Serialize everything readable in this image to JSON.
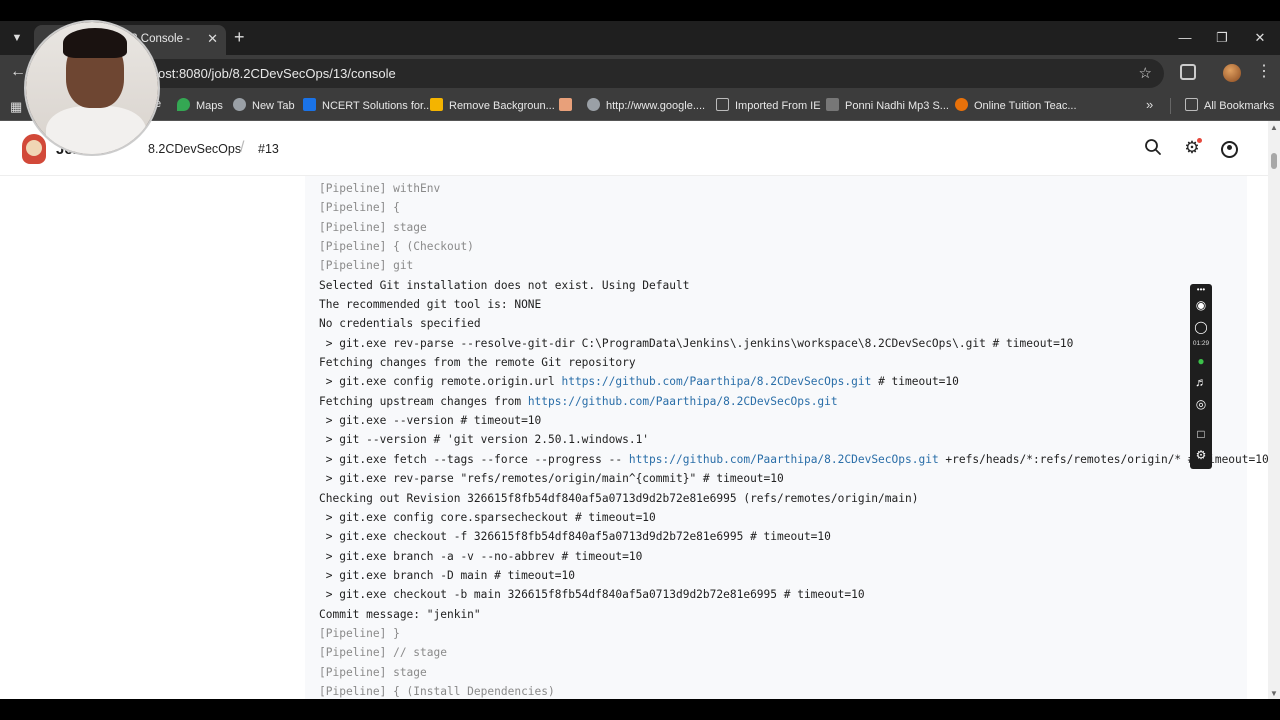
{
  "browser": {
    "tab_title": "#13 Console -",
    "url": "localhost:8080/job/8.2CDevSecOps/13/console",
    "url_visible": "ost:8080/job/8.2CDevSecOps/13/console",
    "icons": {
      "tab_list": "chevron-down-icon",
      "close": "close-icon",
      "new_tab": "plus-icon",
      "back": "back-arrow-icon",
      "star": "star-icon",
      "extensions": "puzzle-icon",
      "menu": "kebab-menu-icon"
    }
  },
  "bookmarks": {
    "items": [
      {
        "label": "e",
        "icon": "bookmark-icon",
        "color": "#555555"
      },
      {
        "label": "Maps",
        "icon": "maps-icon",
        "color": "#34a853"
      },
      {
        "label": "New Tab",
        "icon": "globe-icon",
        "color": "#9aa0a6"
      },
      {
        "label": "NCERT Solutions for...",
        "icon": "ncert-icon",
        "color": "#1a73e8"
      },
      {
        "label": "Remove Backgroun...",
        "icon": "removebg-icon",
        "color": "#f4b400"
      },
      {
        "label": "",
        "icon": "image-icon",
        "color": "#e8a07a"
      },
      {
        "label": "http://www.google....",
        "icon": "globe-icon",
        "color": "#9aa0a6"
      },
      {
        "label": "Imported From IE",
        "icon": "folder-icon",
        "color": "#9aa0a6"
      },
      {
        "label": "Ponni Nadhi Mp3 S...",
        "icon": "music-icon",
        "color": "#777777"
      },
      {
        "label": "Online Tuition Teac...",
        "icon": "v-logo-icon",
        "color": "#e8710a"
      }
    ],
    "all_bookmarks": "All Bookmarks"
  },
  "jenkins": {
    "brand": "Jenkins",
    "brand_visible": "Je...s",
    "breadcrumb": [
      "8.2CDevSecOps",
      "#13"
    ],
    "header_icons": [
      "search-icon",
      "gear-icon",
      "user-icon"
    ]
  },
  "console": {
    "lines": [
      {
        "t": "[Pipeline] withEnv",
        "kind": "pipe"
      },
      {
        "t": "[Pipeline] {",
        "kind": "pipe"
      },
      {
        "t": "[Pipeline] stage",
        "kind": "pipe"
      },
      {
        "t": "[Pipeline] { (Checkout)",
        "kind": "pipe"
      },
      {
        "t": "[Pipeline] git",
        "kind": "pipe"
      },
      {
        "t": "Selected Git installation does not exist. Using Default",
        "kind": "text"
      },
      {
        "t": "The recommended git tool is: NONE",
        "kind": "text"
      },
      {
        "t": "No credentials specified",
        "kind": "text"
      },
      {
        "t": " > git.exe rev-parse --resolve-git-dir C:\\ProgramData\\Jenkins\\.jenkins\\workspace\\8.2CDevSecOps\\.git # timeout=10",
        "kind": "text"
      },
      {
        "t": "Fetching changes from the remote Git repository",
        "kind": "text"
      },
      {
        "pre": " > git.exe config remote.origin.url ",
        "link": "https://github.com/Paarthipa/8.2CDevSecOps.git",
        "post": " # timeout=10",
        "kind": "link"
      },
      {
        "pre": "Fetching upstream changes from ",
        "link": "https://github.com/Paarthipa/8.2CDevSecOps.git",
        "post": "",
        "kind": "link"
      },
      {
        "t": " > git.exe --version # timeout=10",
        "kind": "text"
      },
      {
        "t": " > git --version # 'git version 2.50.1.windows.1'",
        "kind": "text"
      },
      {
        "pre": " > git.exe fetch --tags --force --progress -- ",
        "link": "https://github.com/Paarthipa/8.2CDevSecOps.git",
        "post": " +refs/heads/*:refs/remotes/origin/* # timeout=10",
        "kind": "link"
      },
      {
        "t": " > git.exe rev-parse \"refs/remotes/origin/main^{commit}\" # timeout=10",
        "kind": "text"
      },
      {
        "t": "Checking out Revision 326615f8fb54df840af5a0713d9d2b72e81e6995 (refs/remotes/origin/main)",
        "kind": "text"
      },
      {
        "t": " > git.exe config core.sparsecheckout # timeout=10",
        "kind": "text"
      },
      {
        "t": " > git.exe checkout -f 326615f8fb54df840af5a0713d9d2b72e81e6995 # timeout=10",
        "kind": "text"
      },
      {
        "t": " > git.exe branch -a -v --no-abbrev # timeout=10",
        "kind": "text"
      },
      {
        "t": " > git.exe branch -D main # timeout=10",
        "kind": "text"
      },
      {
        "t": " > git.exe checkout -b main 326615f8fb54df840af5a0713d9d2b72e81e6995 # timeout=10",
        "kind": "text"
      },
      {
        "t": "Commit message: \"jenkin\"",
        "kind": "text"
      },
      {
        "t": "[Pipeline] }",
        "kind": "pipe"
      },
      {
        "t": "[Pipeline] // stage",
        "kind": "pipe"
      },
      {
        "t": "[Pipeline] stage",
        "kind": "pipe"
      },
      {
        "t": "[Pipeline] { (Install Dependencies)",
        "kind": "pipe"
      }
    ]
  },
  "recorder": {
    "elapsed": "01:29",
    "icons": [
      "pin-icon",
      "camera-icon",
      "record-icon",
      "microphone-icon",
      "speaker-icon",
      "webcam-icon",
      "screen-icon",
      "settings-icon"
    ]
  },
  "colors": {
    "pipeline_gray": "#8a8a8a",
    "link_blue": "#2a6ea8",
    "jenkins_red": "#d24939"
  }
}
